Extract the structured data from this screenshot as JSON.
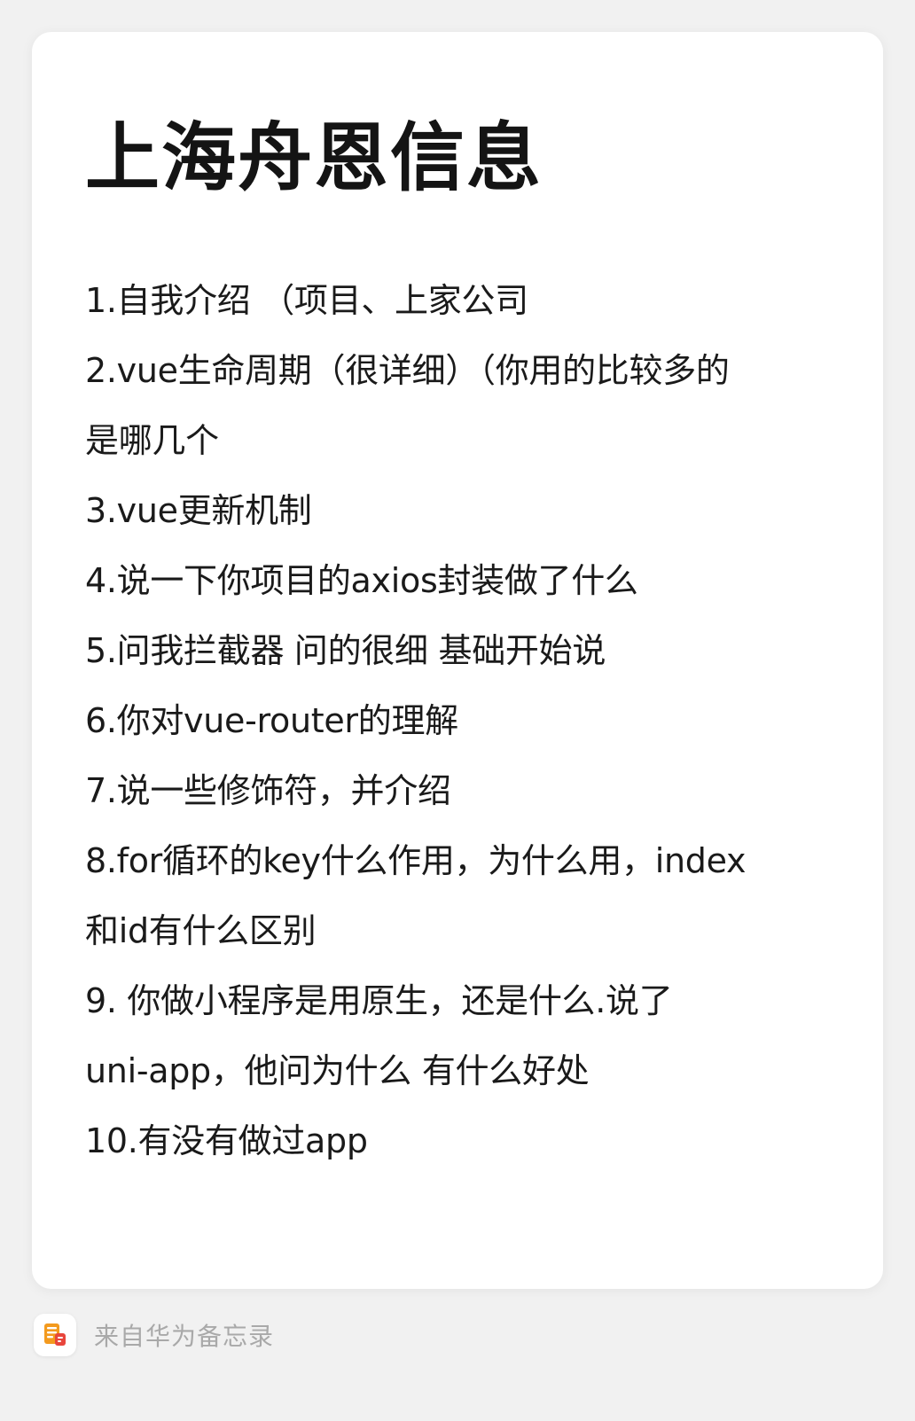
{
  "note": {
    "title": "上海舟恩信息",
    "lines": [
      "1.自我介绍 （项目、上家公司",
      "2.vue生命周期（很详细）（你用的比较多的",
      "是哪几个",
      "3.vue更新机制",
      "4.说一下你项目的axios封装做了什么",
      "5.问我拦截器 问的很细 基础开始说",
      "6.你对vue-router的理解",
      "7.说一些修饰符，并介绍",
      "8.for循环的key什么作用，为什么用，index",
      "和id有什么区别",
      "9. 你做小程序是用原生，还是什么.说了",
      "uni-app，他问为什么 有什么好处",
      "10.有没有做过app"
    ]
  },
  "footer": {
    "icon": "notepad-app-icon",
    "text": "来自华为备忘录"
  },
  "colors": {
    "background": "#f1f1f1",
    "card": "#ffffff",
    "text": "#1a1a1a",
    "footer_text": "#a9a9a9",
    "icon_orange": "#f39a1e",
    "icon_red": "#e8453c"
  }
}
